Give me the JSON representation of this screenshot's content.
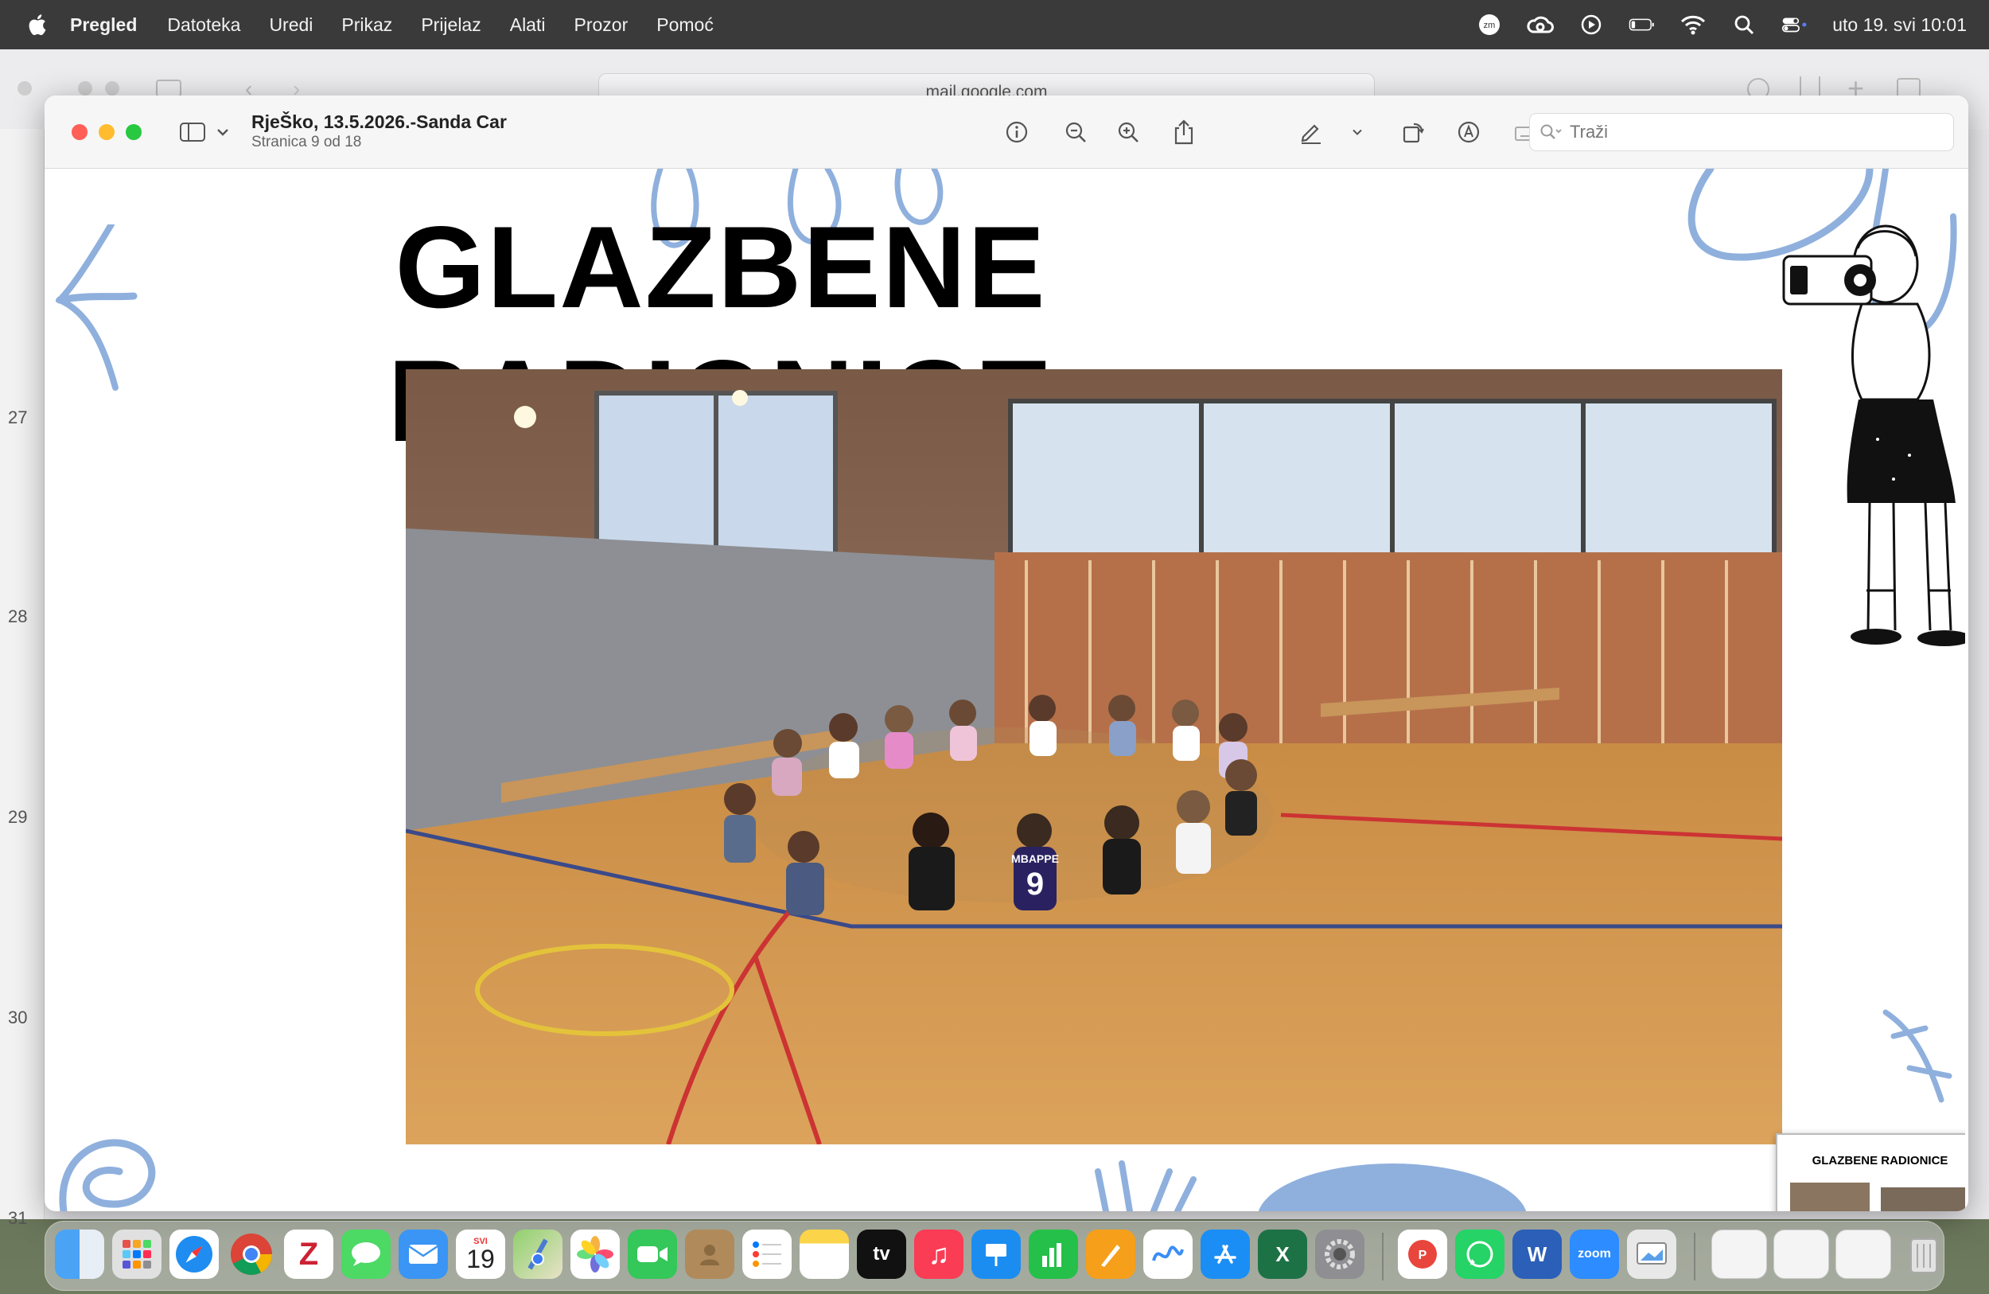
{
  "menubar": {
    "app": "Pregled",
    "items": [
      "Datoteka",
      "Uredi",
      "Prikaz",
      "Prijelaz",
      "Alati",
      "Prozor",
      "Pomoć"
    ],
    "clock": "uto 19. svi  10:01"
  },
  "background_window": {
    "url": "mail.google.com",
    "sidebar_numbers": [
      "27",
      "28",
      "29",
      "30",
      "31"
    ]
  },
  "preview": {
    "title": "RjeŠko, 13.5.2026.-Sanda Car",
    "subtitle": "Stranica 9 od 18",
    "search_placeholder": "Traži"
  },
  "slide": {
    "title": "GLAZBENE RADIONICE",
    "jersey_text": "MBAPPE",
    "jersey_number": "9"
  },
  "thumbnail": {
    "title": "GLAZBENE RADIONICE"
  },
  "dock": {
    "calendar_month": "SVI",
    "calendar_day": "19",
    "tv_label": "tv",
    "zoom_label": "zoom"
  }
}
